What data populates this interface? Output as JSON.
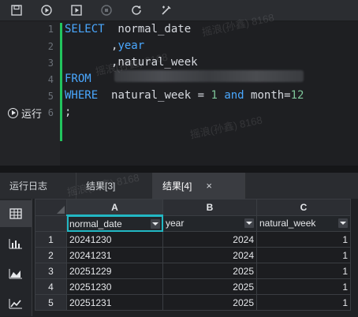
{
  "toolbar": {
    "icons": [
      "save-icon",
      "play-icon",
      "run-script-icon",
      "stop-icon",
      "refresh-icon",
      "format-icon"
    ]
  },
  "editor": {
    "line_numbers": [
      "1",
      "2",
      "3",
      "4",
      "5",
      "6"
    ],
    "lines": {
      "l1_kw": "SELECT",
      "l1_rest": "  normal_date",
      "l2_prefix": "       ,",
      "l2_kw": "year",
      "l3": "       ,natural_week",
      "l4_kw": "FROM",
      "l5_kw": "WHERE",
      "l5_a": "  natural_week = ",
      "l5_num1": "1",
      "l5_and": " and",
      "l5_b": " month=",
      "l5_num2": "12",
      "l6": ";"
    },
    "run_label": "运行",
    "watermarks": [
      "摇浪(孙鑫) 8168",
      "摇浪(孙鑫) 8168",
      "摇浪(孙鑫) 8168",
      "摇浪(孙鑫) 8168"
    ]
  },
  "tabs": {
    "log": "运行日志",
    "result3": "结果[3]",
    "result4": "结果[4]",
    "close": "×"
  },
  "result": {
    "col_letters": [
      "A",
      "B",
      "C"
    ],
    "headers": [
      "normal_date",
      "year",
      "natural_week"
    ],
    "rows": [
      {
        "n": "1",
        "date": "20241230",
        "year": "2024",
        "week": "1"
      },
      {
        "n": "2",
        "date": "20241231",
        "year": "2024",
        "week": "1"
      },
      {
        "n": "3",
        "date": "20251229",
        "year": "2025",
        "week": "1"
      },
      {
        "n": "4",
        "date": "20251230",
        "year": "2025",
        "week": "1"
      },
      {
        "n": "5",
        "date": "20251231",
        "year": "2025",
        "week": "1"
      }
    ]
  },
  "colors": {
    "keyword": "#4aa8ff",
    "number": "#7ec699",
    "accent": "#22b8c4",
    "gutter_bar": "#22c55e"
  }
}
